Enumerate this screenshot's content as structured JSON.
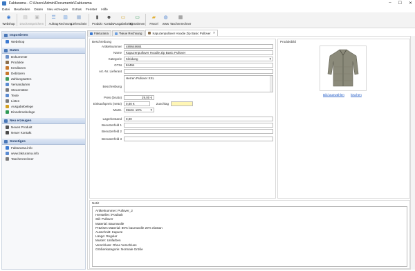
{
  "window": {
    "title": "Fakturama - C:\\Users\\Admin\\Documents\\Fakturama"
  },
  "menu": [
    "Datei",
    "Bearbeiten",
    "Daten",
    "Neu erzeugen",
    "Extras",
    "Fenster",
    "Hilfe"
  ],
  "toolbar": [
    {
      "label": "Webshop",
      "icon": "webshop-icon",
      "color": "#3b7ad1",
      "glyph": "◉",
      "disabled": false
    },
    {
      "label": "Drucken",
      "icon": "print-icon",
      "color": "#b8b8b8",
      "glyph": "▤",
      "disabled": true
    },
    {
      "label": "Speichern",
      "icon": "save-icon",
      "color": "#b8b8b8",
      "glyph": "▣",
      "disabled": true
    },
    {
      "label": "Auftrag",
      "icon": "order-icon",
      "color": "#5b8fd6",
      "glyph": "☰",
      "disabled": false
    },
    {
      "label": "Rechnung",
      "icon": "invoice-icon",
      "color": "#6c9fe0",
      "glyph": "▥",
      "disabled": false
    },
    {
      "label": "Lieferschein",
      "icon": "delivery-icon",
      "color": "#8aa7cf",
      "glyph": "▦",
      "disabled": false
    },
    {
      "label": "Produkt",
      "icon": "product-icon",
      "color": "#555555",
      "glyph": "▮",
      "disabled": false
    },
    {
      "label": "Kontakt",
      "icon": "contact-icon",
      "color": "#4a4a4a",
      "glyph": "☻",
      "disabled": false
    },
    {
      "label": "Ausgabebeleg",
      "icon": "expense-icon",
      "color": "#d4a020",
      "glyph": "▭",
      "disabled": false
    },
    {
      "label": "Einnahmen",
      "icon": "income-icon",
      "color": "#2f9a55",
      "glyph": "▭",
      "disabled": false
    },
    {
      "label": "Parcel",
      "icon": "parcel-icon",
      "color": "#e2b23b",
      "glyph": "▰",
      "disabled": false
    },
    {
      "label": "www",
      "icon": "web-icon",
      "color": "#5a8bd2",
      "glyph": "◍",
      "disabled": false
    },
    {
      "label": "Taschenrechner",
      "icon": "calculator-icon",
      "color": "#7a7a7a",
      "glyph": "▦",
      "disabled": false
    }
  ],
  "sidebar": {
    "sections": [
      {
        "title": "Importieren",
        "icon": "import-icon",
        "items": [
          {
            "label": "Webshop",
            "icon": "webshop-icon",
            "color": "#3b7ad1"
          }
        ]
      },
      {
        "title": "Daten",
        "icon": "data-icon",
        "items": [
          {
            "label": "Dokumente",
            "icon": "documents-icon",
            "color": "#6a8fc7"
          },
          {
            "label": "Produkte",
            "icon": "products-icon",
            "color": "#8a6f4e"
          },
          {
            "label": "Kreditoren",
            "icon": "creditors-icon",
            "color": "#c7782d"
          },
          {
            "label": "Debitoren",
            "icon": "debtors-icon",
            "color": "#c7782d"
          },
          {
            "label": "Zahlungsarten",
            "icon": "payment-icon",
            "color": "#3e9a59"
          },
          {
            "label": "Versandarten",
            "icon": "shipping-icon",
            "color": "#5a8bd2"
          },
          {
            "label": "Steuersätze",
            "icon": "tax-icon",
            "color": "#7a7a7a"
          },
          {
            "label": "Texte",
            "icon": "text-icon",
            "color": "#5a8bd2"
          },
          {
            "label": "Listen",
            "icon": "list-icon",
            "color": "#7a7a7a"
          },
          {
            "label": "Ausgabebelege",
            "icon": "expense-icon",
            "color": "#d4a020"
          },
          {
            "label": "Einnahmebelege",
            "icon": "income-icon",
            "color": "#2f9a55"
          }
        ]
      },
      {
        "title": "Neu erzeugen",
        "icon": "create-icon",
        "items": [
          {
            "label": "Neues Produkt",
            "icon": "new-product-icon",
            "color": "#555555"
          },
          {
            "label": "Neuer Kontakt",
            "icon": "new-contact-icon",
            "color": "#4a4a4a"
          }
        ]
      },
      {
        "title": "Sonstiges",
        "icon": "misc-icon",
        "items": [
          {
            "label": "Fakturama.info",
            "icon": "info-icon",
            "color": "#3b7ad1"
          },
          {
            "label": "www.fakturama.info",
            "icon": "web-icon",
            "color": "#5a8bd2"
          },
          {
            "label": "Taschenrechner",
            "icon": "calculator-icon",
            "color": "#7a7a7a"
          }
        ]
      }
    ]
  },
  "tabs": [
    {
      "label": "Fakturama",
      "active": false,
      "closable": false
    },
    {
      "label": "*Neue Rechnung",
      "active": false,
      "closable": false
    },
    {
      "label": "Kapuzenpullover Hoodie Zip Basic Pullover",
      "active": true,
      "closable": true
    }
  ],
  "form": {
    "section_title": "Beschreibung",
    "fields": {
      "artikelnummer": {
        "label": "Artikelnummer",
        "value": "489648684"
      },
      "name": {
        "label": "Name",
        "value": "Kapuzenpullover Hoodie Zip Basic Pullover"
      },
      "kategorie": {
        "label": "Kategorie",
        "value": "Kleidung"
      },
      "gtin": {
        "label": "GTIN",
        "value": "84464"
      },
      "lieferant": {
        "label": "Art.-Nr. Lieferant",
        "value": ""
      },
      "beschreibung": {
        "label": "Beschreibung",
        "value": "Herren Pullover XXL"
      },
      "preis": {
        "label": "Preis (brutto)",
        "value": "29,00 €"
      },
      "einkaufspreis": {
        "label": "Einkaufspreis (netto)",
        "value": "0,00 €"
      },
      "zuschlag": {
        "label": "Zuschlag",
        "value": ""
      },
      "mwst": {
        "label": "MwSt.",
        "value": "MwSt. 19%"
      },
      "lagerbestand": {
        "label": "Lagerbestand",
        "value": "0,00"
      },
      "benutzerfeld1": {
        "label": "Benutzerfeld 1",
        "value": ""
      },
      "benutzerfeld2": {
        "label": "Benutzerfeld 2",
        "value": ""
      },
      "benutzerfeld3": {
        "label": "Benutzerfeld 3",
        "value": ""
      }
    }
  },
  "image_panel": {
    "title": "Produktbild",
    "select_label": "Bild auswählen",
    "delete_label": "löschen"
  },
  "notes": {
    "title": "Notiz",
    "lines": [
      "Artikelnummer: Pullover_2",
      "Hersteller: iPosfash",
      "Stil: Pullover",
      "Material: Baumwolle",
      "Präzises Material: 80% baumwolle 20% elastan",
      "Ausschnitt: Kapuze",
      "Länge: Regular",
      "Muster: Unifarben",
      "Verschluss: Ohne Verschluss",
      "Größenkategorie: Normale Größe"
    ]
  }
}
